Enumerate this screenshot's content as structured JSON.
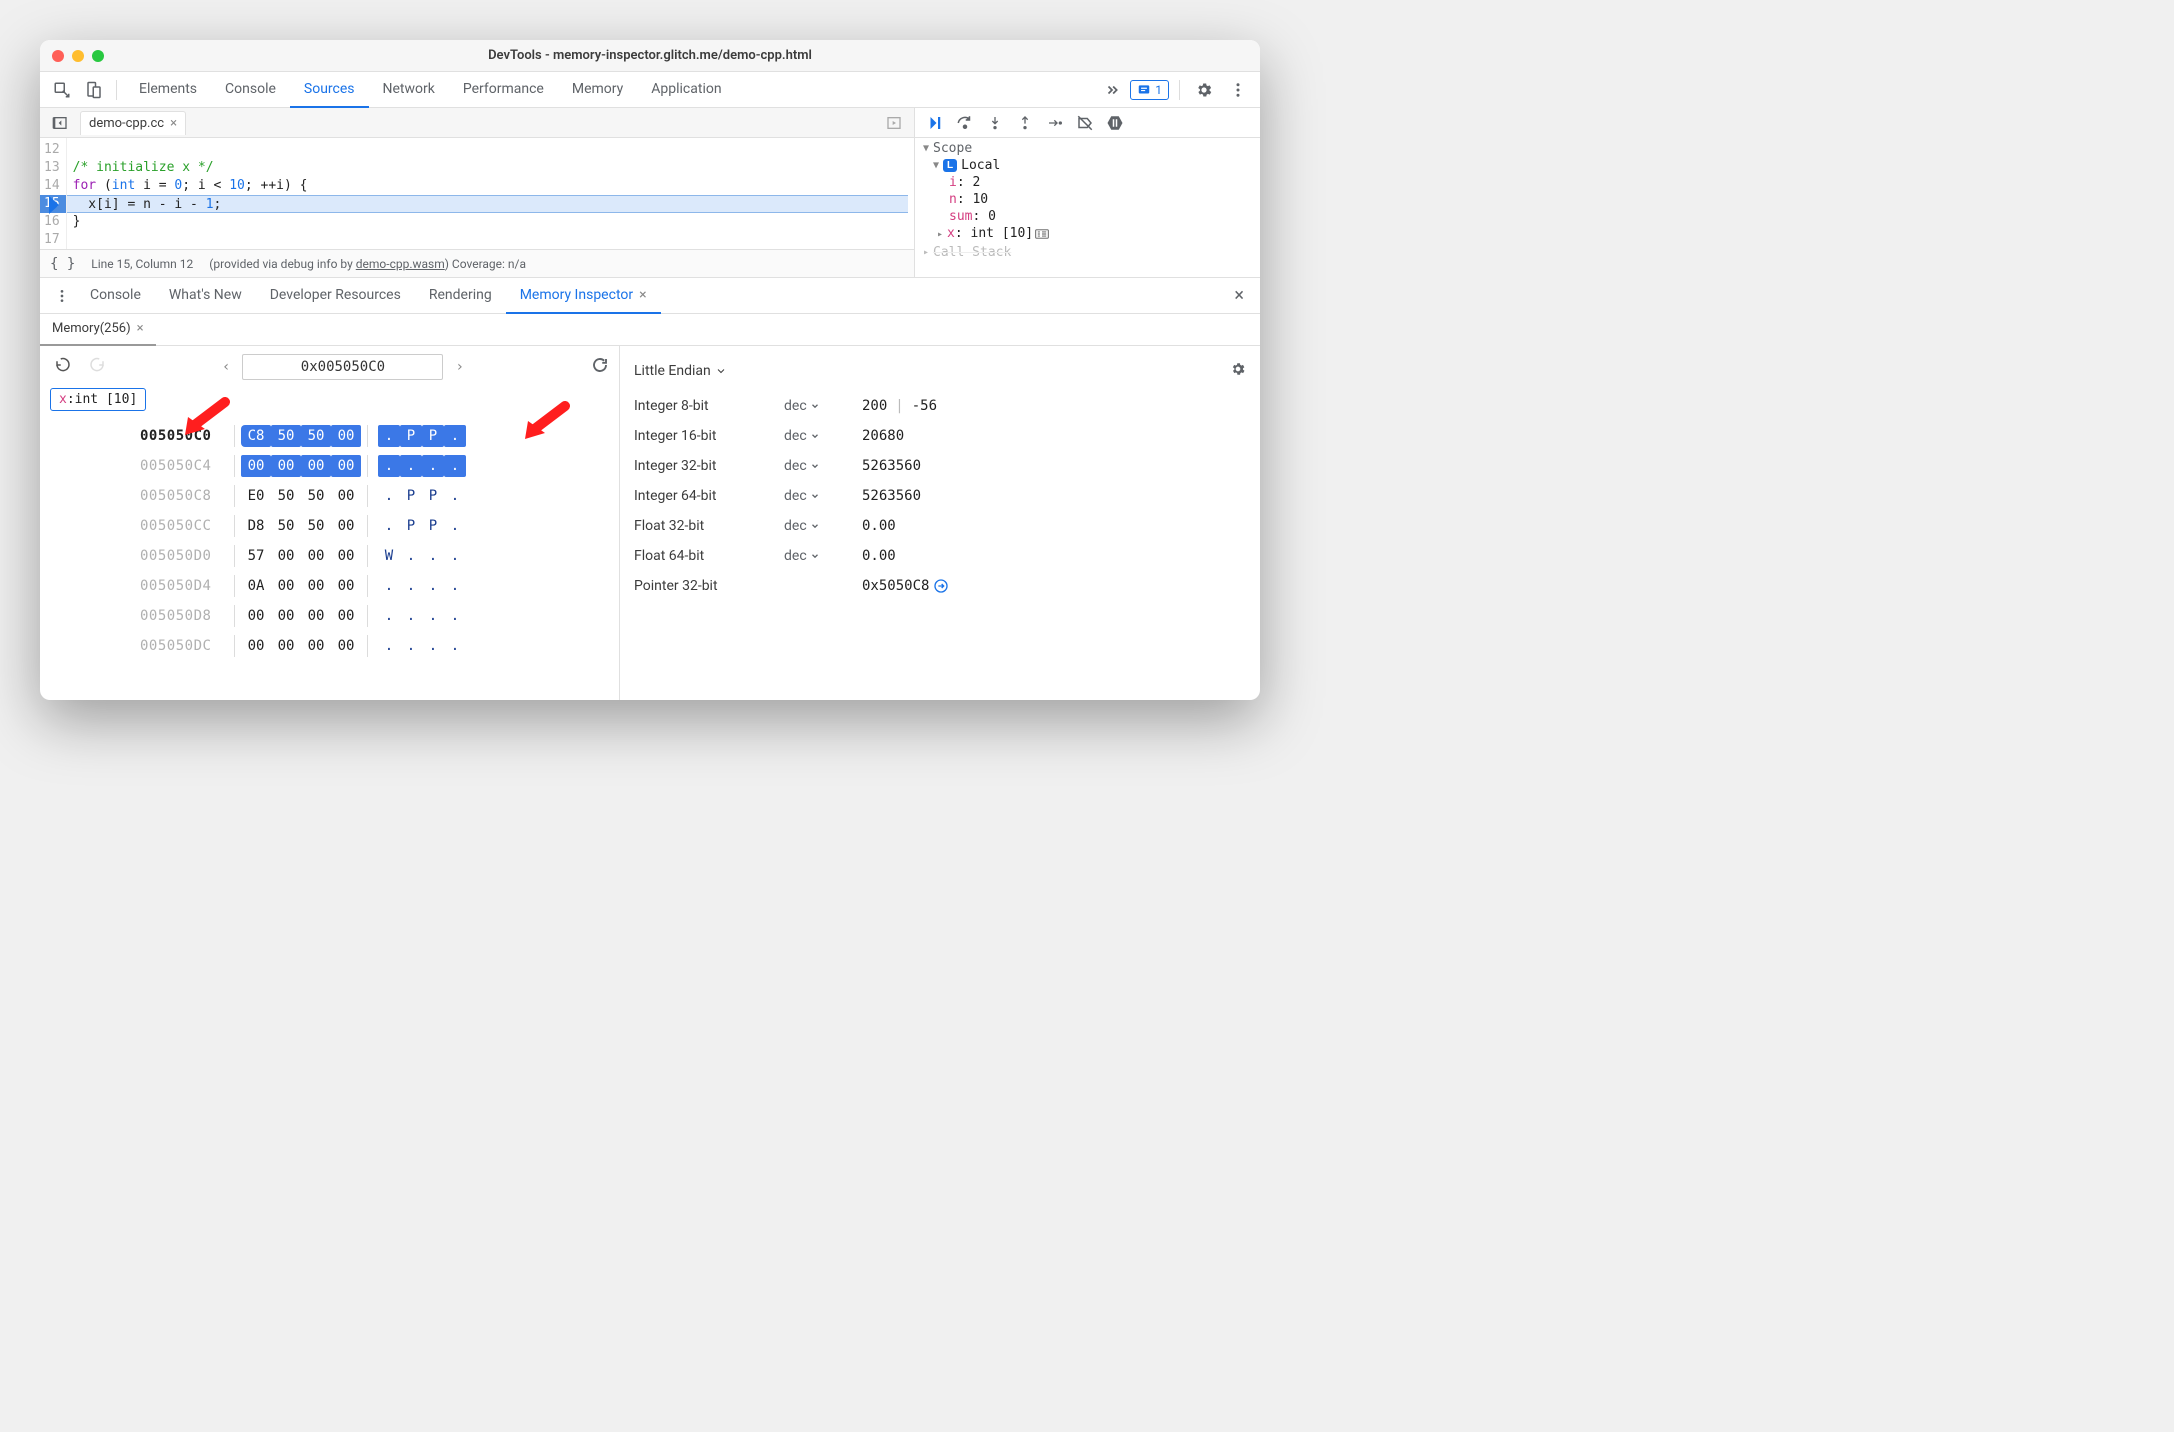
{
  "window": {
    "title": "DevTools - memory-inspector.glitch.me/demo-cpp.html"
  },
  "panels": {
    "tabs": [
      "Elements",
      "Console",
      "Sources",
      "Network",
      "Performance",
      "Memory",
      "Application"
    ],
    "activeIndex": 2,
    "issues_count": "1"
  },
  "editor": {
    "tab_label": "demo-cpp.cc",
    "lines": [
      {
        "n": 12,
        "html": ""
      },
      {
        "n": 13,
        "html": "<span class='cm-cmt'>/* initialize x */</span>"
      },
      {
        "n": 14,
        "html": "<span class='cm-kw'>for</span> (<span class='cm-type'>int</span> i = <span class='cm-num'>0</span>; i &lt; <span class='cm-num'>10</span>; ++i) {"
      },
      {
        "n": 15,
        "html": "  x[i] = n - i - <span class='cm-num'>1</span>;",
        "current": true
      },
      {
        "n": 16,
        "html": "}"
      },
      {
        "n": 17,
        "html": ""
      }
    ],
    "status_line": "Line 15, Column 12",
    "status_info_pre": "(provided via debug info by ",
    "status_info_link": "demo-cpp.wasm",
    "status_info_post": ") Coverage: n/a"
  },
  "scope": {
    "header": "Scope",
    "local_label": "Local",
    "vars": [
      {
        "name": "i",
        "value": "2"
      },
      {
        "name": "n",
        "value": "10"
      },
      {
        "name": "sum",
        "value": "0"
      },
      {
        "name": "x",
        "value": "int [10]",
        "expandable": true,
        "memicon": true
      }
    ],
    "callstack_label": "Call Stack"
  },
  "drawer": {
    "tabs": [
      "Console",
      "What's New",
      "Developer Resources",
      "Rendering",
      "Memory Inspector"
    ],
    "activeIndex": 4
  },
  "memory": {
    "subtab_label": "Memory(256)",
    "address": "0x005050C0",
    "object_chip": {
      "name": "x",
      "type": "int [10]"
    },
    "rows": [
      {
        "addr": "005050C0",
        "current": true,
        "hl": true,
        "bytes": [
          "C8",
          "50",
          "50",
          "00"
        ],
        "ascii": [
          ".",
          "P",
          "P",
          "."
        ]
      },
      {
        "addr": "005050C4",
        "hl": true,
        "bytes": [
          "00",
          "00",
          "00",
          "00"
        ],
        "ascii": [
          ".",
          ".",
          ".",
          "."
        ]
      },
      {
        "addr": "005050C8",
        "bytes": [
          "E0",
          "50",
          "50",
          "00"
        ],
        "ascii": [
          ".",
          "P",
          "P",
          "."
        ]
      },
      {
        "addr": "005050CC",
        "bytes": [
          "D8",
          "50",
          "50",
          "00"
        ],
        "ascii": [
          ".",
          "P",
          "P",
          "."
        ]
      },
      {
        "addr": "005050D0",
        "bytes": [
          "57",
          "00",
          "00",
          "00"
        ],
        "ascii": [
          "W",
          ".",
          ".",
          "."
        ]
      },
      {
        "addr": "005050D4",
        "bytes": [
          "0A",
          "00",
          "00",
          "00"
        ],
        "ascii": [
          ".",
          ".",
          ".",
          "."
        ]
      },
      {
        "addr": "005050D8",
        "bytes": [
          "00",
          "00",
          "00",
          "00"
        ],
        "ascii": [
          ".",
          ".",
          ".",
          "."
        ]
      },
      {
        "addr": "005050DC",
        "bytes": [
          "00",
          "00",
          "00",
          "00"
        ],
        "ascii": [
          ".",
          ".",
          ".",
          "."
        ]
      }
    ]
  },
  "values": {
    "endianness": "Little Endian",
    "rows": [
      {
        "label": "Integer 8-bit",
        "mode": "dec",
        "value": "200",
        "alt": "-56"
      },
      {
        "label": "Integer 16-bit",
        "mode": "dec",
        "value": "20680"
      },
      {
        "label": "Integer 32-bit",
        "mode": "dec",
        "value": "5263560"
      },
      {
        "label": "Integer 64-bit",
        "mode": "dec",
        "value": "5263560"
      },
      {
        "label": "Float 32-bit",
        "mode": "dec",
        "value": "0.00"
      },
      {
        "label": "Float 64-bit",
        "mode": "dec",
        "value": "0.00"
      },
      {
        "label": "Pointer 32-bit",
        "mode": "",
        "value": "0x5050C8",
        "jump": true
      }
    ]
  }
}
